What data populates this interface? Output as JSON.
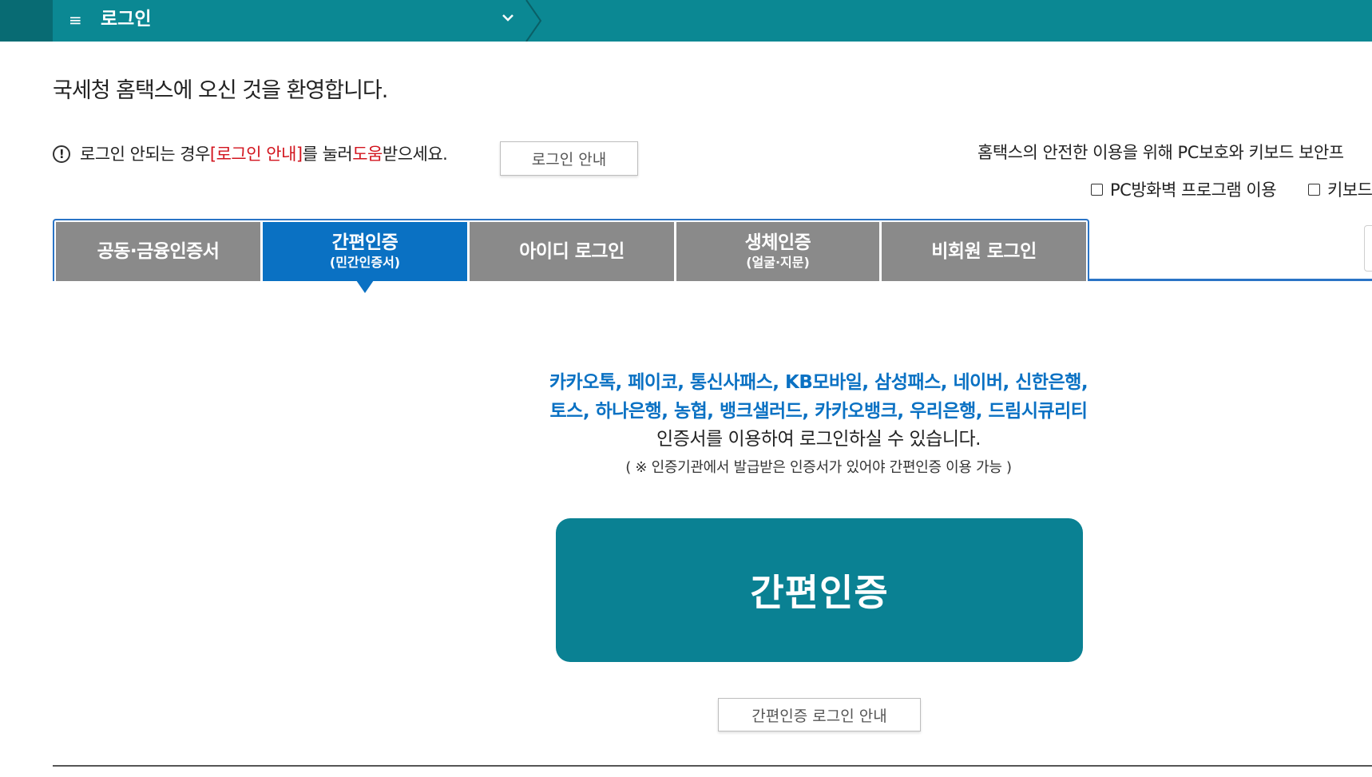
{
  "header": {
    "menu_icon": "≡",
    "title": "로그인",
    "chevron": "˅"
  },
  "welcome": "국세청 홈택스에 오신 것을 환영합니다.",
  "notice": {
    "prefix": "로그인 안되는 경우 ",
    "link": "[로그인 안내]",
    "middle": "를 눌러 ",
    "help": "도움",
    "suffix": "받으세요.",
    "button": "로그인 안내"
  },
  "security": {
    "text": "홈택스의 안전한 이용을 위해 PC보호와 키보드 보안프",
    "option1": "PC방화벽 프로그램 이용",
    "option2": "키보드"
  },
  "tabs": [
    {
      "label": "공동·금융인증서",
      "sub": ""
    },
    {
      "label": "간편인증",
      "sub": "(민간인증서)"
    },
    {
      "label": "아이디 로그인",
      "sub": ""
    },
    {
      "label": "생체인증",
      "sub": "(얼굴·지문)"
    },
    {
      "label": "비회원 로그인",
      "sub": ""
    }
  ],
  "content": {
    "providers_line1": "카카오톡, 페이코, 통신사패스, KB모바일, 삼성패스, 네이버, 신한은행,",
    "providers_line2": "토스, 하나은행, 농협, 뱅크샐러드, 카카오뱅크, 우리은행, 드림시큐리티",
    "description": "인증서를 이용하여 로그인하실 수 있습니다.",
    "note": "( ※ 인증기관에서 발급받은 인증서가 있어야 간편인증 이용 가능 )",
    "main_button": "간편인증",
    "guide_button": "간편인증 로그인 안내"
  }
}
